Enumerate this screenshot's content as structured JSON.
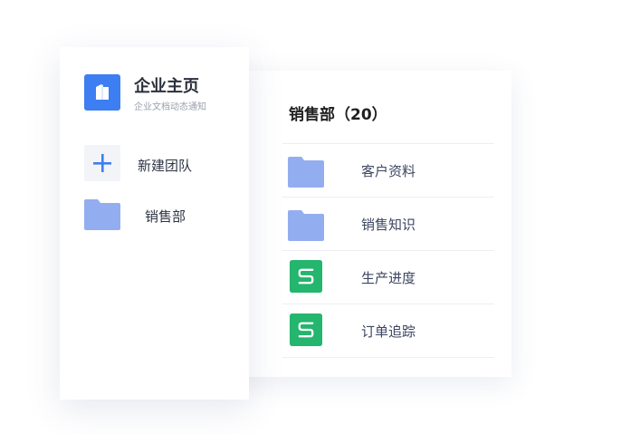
{
  "sidebar": {
    "app_title": "企业主页",
    "app_subtitle": "企业文档动态通知",
    "logo_icon": "book-logo-icon",
    "new_team_label": "新建团队",
    "new_team_icon": "plus-icon",
    "department_label": "销售部",
    "department_icon": "folder-icon"
  },
  "main": {
    "title": "销售部（20）",
    "items": [
      {
        "label": "客户资料",
        "icon": "folder-icon"
      },
      {
        "label": "销售知识",
        "icon": "folder-icon"
      },
      {
        "label": "生产进度",
        "icon": "spreadsheet-icon"
      },
      {
        "label": "订单追踪",
        "icon": "spreadsheet-icon"
      }
    ]
  },
  "colors": {
    "accent_blue": "#3d7ef2",
    "folder": "#93aef0",
    "sheet_green": "#24b56e",
    "background": "#ffffff"
  }
}
